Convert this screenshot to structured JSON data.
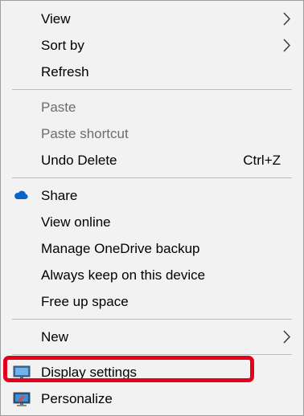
{
  "menu": {
    "items": [
      {
        "label": "View",
        "has_submenu": true
      },
      {
        "label": "Sort by",
        "has_submenu": true
      },
      {
        "label": "Refresh"
      },
      {
        "label": "Paste",
        "disabled": true
      },
      {
        "label": "Paste shortcut",
        "disabled": true
      },
      {
        "label": "Undo Delete",
        "shortcut": "Ctrl+Z"
      },
      {
        "label": "Share",
        "icon": "onedrive-cloud-icon"
      },
      {
        "label": "View online"
      },
      {
        "label": "Manage OneDrive backup"
      },
      {
        "label": "Always keep on this device"
      },
      {
        "label": "Free up space"
      },
      {
        "label": "New",
        "has_submenu": true
      },
      {
        "label": "Display settings",
        "icon": "display-monitor-icon",
        "highlighted": true
      },
      {
        "label": "Personalize",
        "icon": "personalize-monitor-icon"
      }
    ]
  },
  "colors": {
    "menu_background": "#f2f2f2",
    "disabled_text": "#6d6d6d",
    "highlight_border": "#e4001b",
    "onedrive_blue": "#0a64c8"
  }
}
